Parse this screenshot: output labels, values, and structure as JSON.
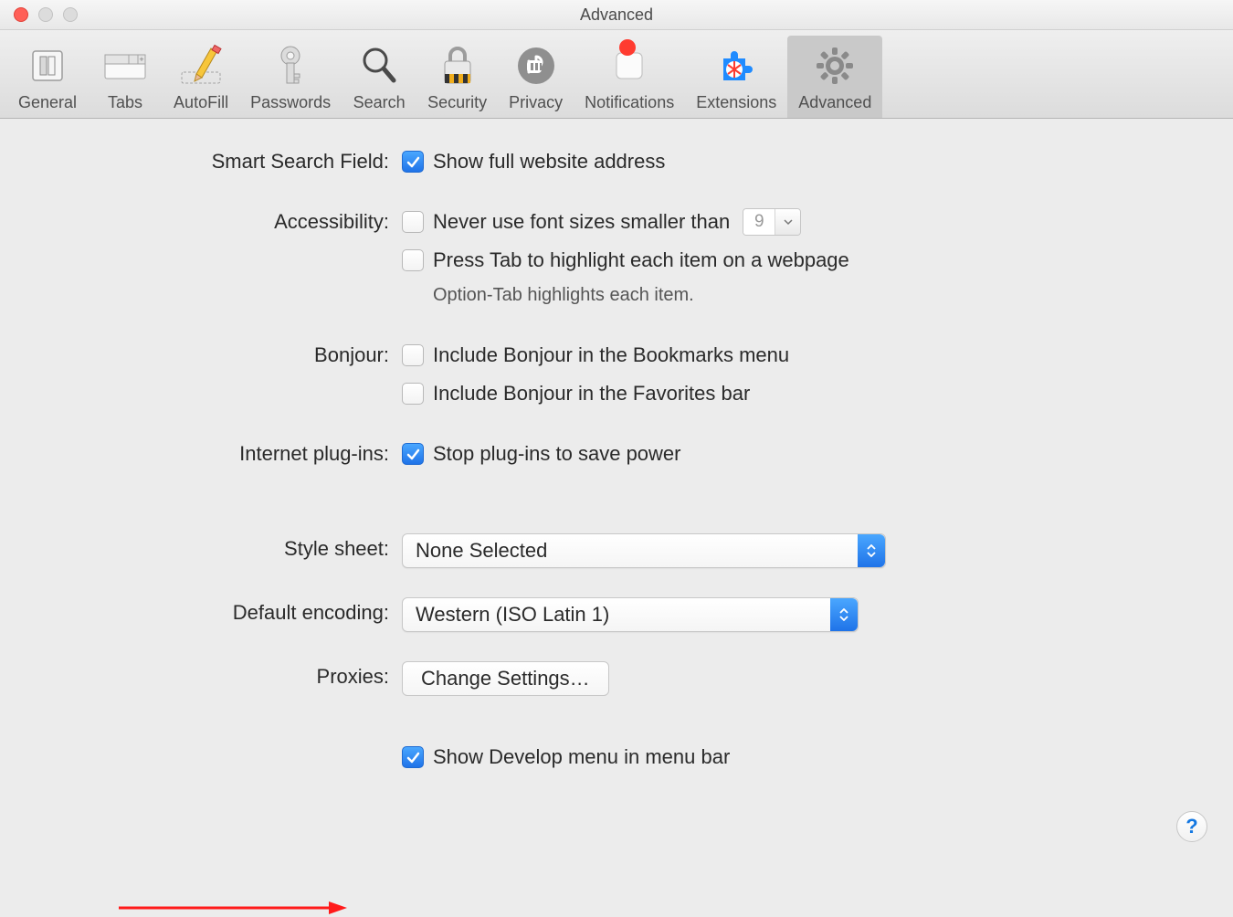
{
  "window": {
    "title": "Advanced"
  },
  "toolbar": [
    {
      "id": "general",
      "label": "General"
    },
    {
      "id": "tabs",
      "label": "Tabs"
    },
    {
      "id": "autofill",
      "label": "AutoFill"
    },
    {
      "id": "passwords",
      "label": "Passwords"
    },
    {
      "id": "search",
      "label": "Search"
    },
    {
      "id": "security",
      "label": "Security"
    },
    {
      "id": "privacy",
      "label": "Privacy"
    },
    {
      "id": "notifications",
      "label": "Notifications"
    },
    {
      "id": "extensions",
      "label": "Extensions"
    },
    {
      "id": "advanced",
      "label": "Advanced",
      "selected": true
    }
  ],
  "sections": {
    "smartSearch": {
      "label": "Smart Search Field:",
      "showFullAddress": {
        "checked": true,
        "label": "Show full website address"
      }
    },
    "accessibility": {
      "label": "Accessibility:",
      "minFontSize": {
        "checked": false,
        "label": "Never use font sizes smaller than",
        "value": "9"
      },
      "pressTab": {
        "checked": false,
        "label": "Press Tab to highlight each item on a webpage"
      },
      "note": "Option-Tab highlights each item."
    },
    "bonjour": {
      "label": "Bonjour:",
      "bookmarks": {
        "checked": false,
        "label": "Include Bonjour in the Bookmarks menu"
      },
      "favorites": {
        "checked": false,
        "label": "Include Bonjour in the Favorites bar"
      }
    },
    "plugins": {
      "label": "Internet plug-ins:",
      "stopToSavePower": {
        "checked": true,
        "label": "Stop plug-ins to save power"
      }
    },
    "stylesheet": {
      "label": "Style sheet:",
      "value": "None Selected"
    },
    "encoding": {
      "label": "Default encoding:",
      "value": "Western (ISO Latin 1)"
    },
    "proxies": {
      "label": "Proxies:",
      "button": "Change Settings…"
    },
    "develop": {
      "checked": true,
      "label": "Show Develop menu in menu bar"
    }
  },
  "help": {
    "label": "?"
  }
}
